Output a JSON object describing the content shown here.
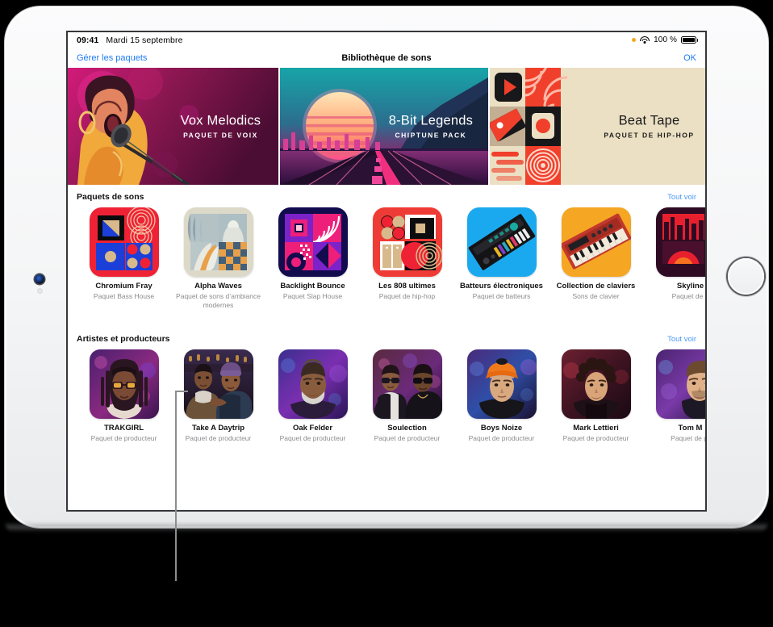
{
  "status_bar": {
    "time": "09:41",
    "date": "Mardi 15 septembre",
    "battery_percent": "100 %",
    "wifi_icon": "wifi-icon",
    "battery_icon": "battery-icon",
    "recording_indicator_icon": "orange-dot-icon"
  },
  "nav": {
    "left_button": "Gérer les paquets",
    "title": "Bibliothèque de sons",
    "right_button": "OK"
  },
  "heroes": [
    {
      "title": "Vox Melodics",
      "subtitle": "PAQUET DE VOIX"
    },
    {
      "title": "8-Bit Legends",
      "subtitle": "CHIPTUNE PACK"
    },
    {
      "title": "Beat Tape",
      "subtitle": "PAQUET DE HIP-HOP"
    }
  ],
  "sections": [
    {
      "title": "Paquets de sons",
      "see_all": "Tout voir",
      "items": [
        {
          "name": "Chromium Fray",
          "sub": "Paquet Bass House"
        },
        {
          "name": "Alpha Waves",
          "sub": "Paquet de sons d’ambiance modernes"
        },
        {
          "name": "Backlight Bounce",
          "sub": "Paquet Slap House"
        },
        {
          "name": "Les 808 ultimes",
          "sub": "Paquet de hip-hop"
        },
        {
          "name": "Batteurs électroniques",
          "sub": "Paquet de batteurs"
        },
        {
          "name": "Collection de claviers",
          "sub": "Sons de clavier"
        },
        {
          "name": "Skyline",
          "sub": "Paquet de b"
        }
      ]
    },
    {
      "title": "Artistes et producteurs",
      "see_all": "Tout voir",
      "items": [
        {
          "name": "TRAKGIRL",
          "sub": "Paquet de producteur"
        },
        {
          "name": "Take A Daytrip",
          "sub": "Paquet de producteur"
        },
        {
          "name": "Oak Felder",
          "sub": "Paquet de producteur"
        },
        {
          "name": "Soulection",
          "sub": "Paquet de producteur"
        },
        {
          "name": "Boys Noize",
          "sub": "Paquet de producteur"
        },
        {
          "name": "Mark Lettieri",
          "sub": "Paquet de producteur"
        },
        {
          "name": "Tom M",
          "sub": "Paquet de pr"
        }
      ]
    }
  ],
  "colors": {
    "accent_blue": "#1f7bf4",
    "see_all_blue": "#4a9bf7",
    "hero1_bg": "#6d1240",
    "hero2_bg": "#1f3b57",
    "hero3_bg": "#ece0c4",
    "subtitle_gray": "#8b8b90"
  }
}
